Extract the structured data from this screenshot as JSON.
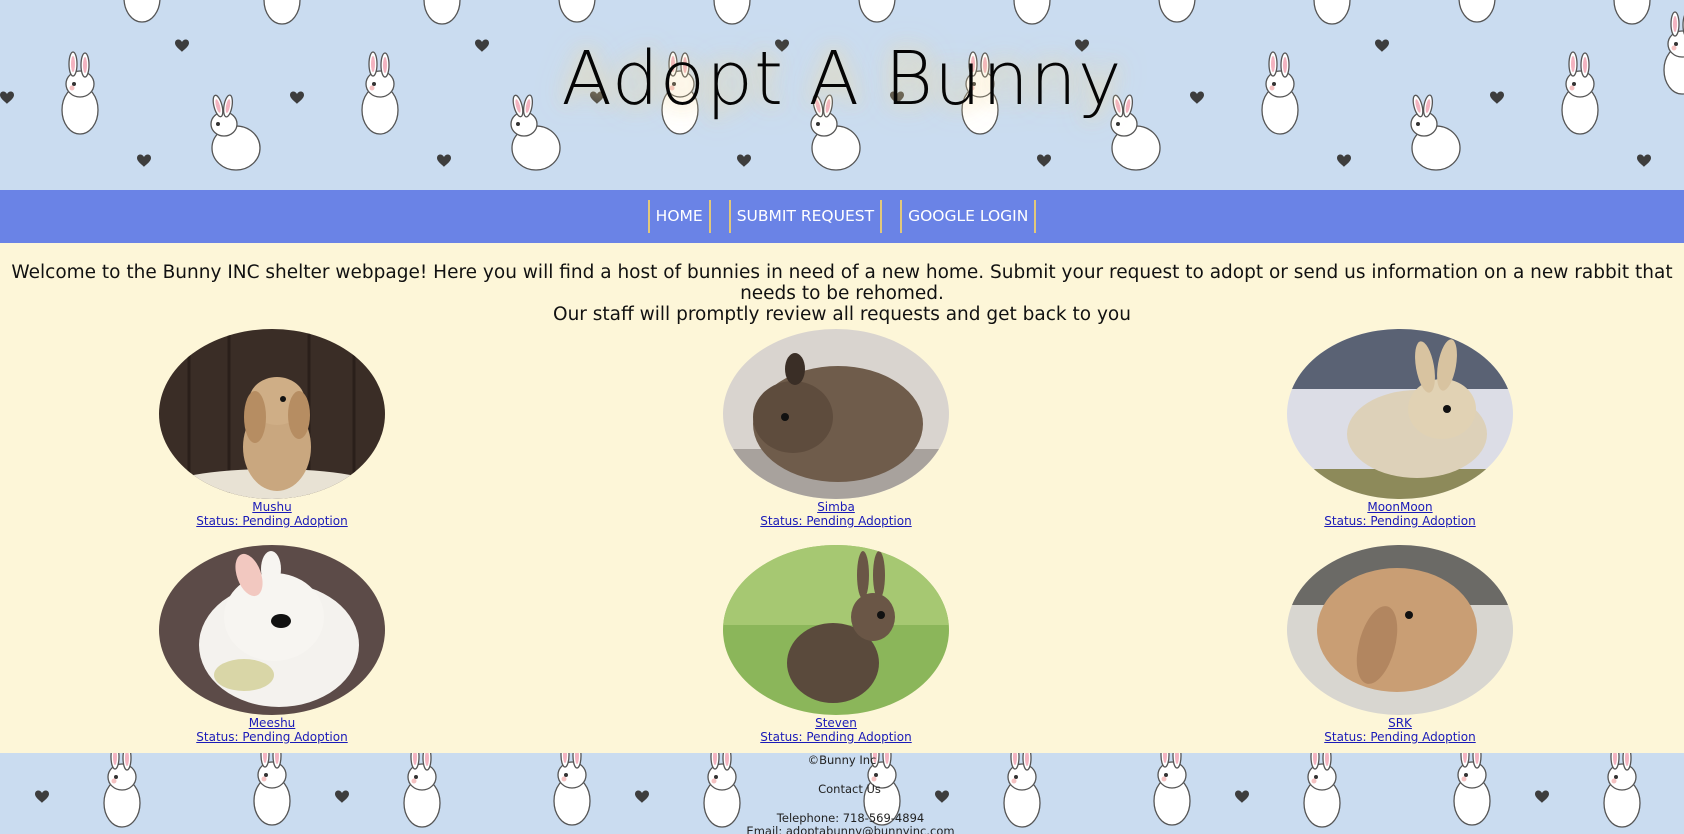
{
  "header": {
    "title": "Adopt A Bunny"
  },
  "nav": {
    "items": [
      {
        "label": "HOME"
      },
      {
        "label": "SUBMIT REQUEST"
      },
      {
        "label": "GOOGLE LOGIN"
      }
    ]
  },
  "intro": {
    "line1": "Welcome to the Bunny INC shelter webpage! Here you will find a host of bunnies in need of a new home. Submit your request to adopt or send us information on a new rabbit that needs to be rehomed.",
    "line2": "Our staff will promptly review all requests and get back to you"
  },
  "bunnies": [
    {
      "name": "Mushu",
      "status": "Status: Pending Adoption"
    },
    {
      "name": "Simba",
      "status": "Status: Pending Adoption"
    },
    {
      "name": "MoonMoon",
      "status": "Status: Pending Adoption"
    },
    {
      "name": "Meeshu",
      "status": "Status: Pending Adoption"
    },
    {
      "name": "Steven",
      "status": "Status: Pending Adoption"
    },
    {
      "name": "SRK",
      "status": "Status: Pending Adoption"
    }
  ],
  "footer": {
    "copyright": "©Bunny Inc",
    "contact_heading": "Contact Us",
    "telephone": "Telephone: 718-569-4894",
    "email": "Email: adoptabunny@bunnyinc.com"
  },
  "colors": {
    "header_bg": "#cadcf0",
    "nav_bg": "#6a83e6",
    "page_bg": "#fdf6d8",
    "link": "#1a1ab8",
    "nav_divider": "#e2c87a"
  }
}
